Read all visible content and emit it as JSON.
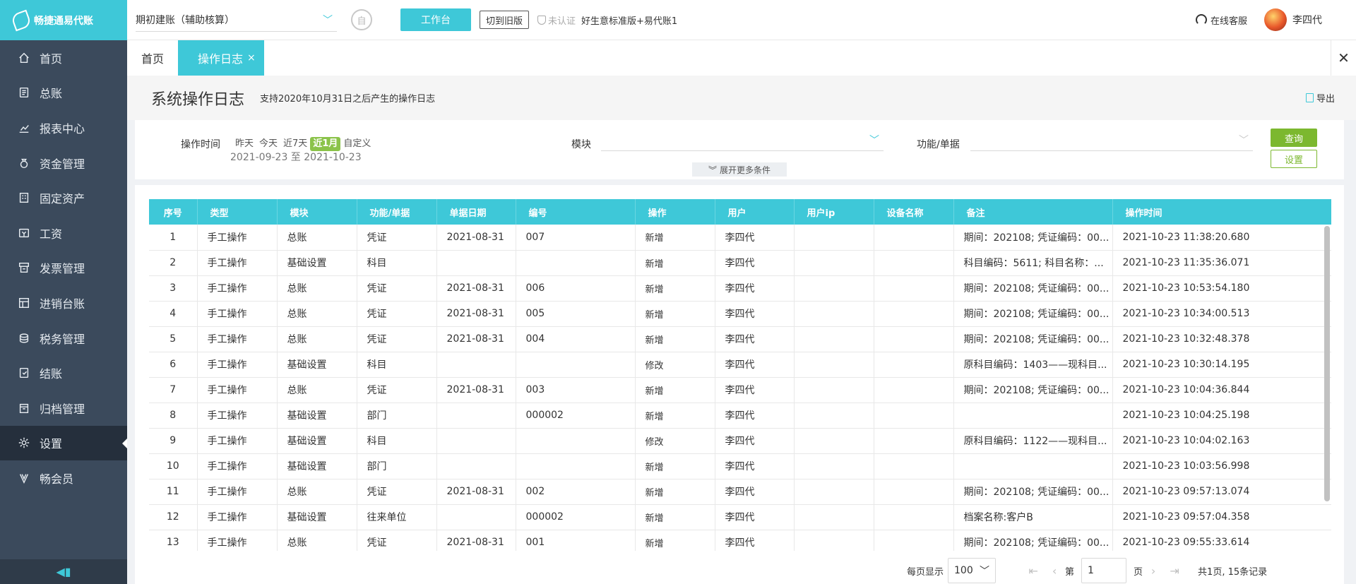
{
  "app": {
    "logo_text": "畅捷通易代账"
  },
  "sidebar": {
    "items": [
      {
        "label": "首页",
        "icon": "home-icon"
      },
      {
        "label": "总账",
        "icon": "ledger-icon"
      },
      {
        "label": "报表中心",
        "icon": "chart-icon"
      },
      {
        "label": "资金管理",
        "icon": "money-bag-icon"
      },
      {
        "label": "固定资产",
        "icon": "building-icon"
      },
      {
        "label": "工资",
        "icon": "salary-icon"
      },
      {
        "label": "发票管理",
        "icon": "invoice-icon"
      },
      {
        "label": "进销台账",
        "icon": "inventory-icon"
      },
      {
        "label": "税务管理",
        "icon": "tax-icon"
      },
      {
        "label": "结账",
        "icon": "checkout-icon"
      },
      {
        "label": "归档管理",
        "icon": "archive-icon"
      },
      {
        "label": "设置",
        "icon": "gear-icon",
        "active": true
      },
      {
        "label": "畅会员",
        "icon": "vip-icon"
      }
    ],
    "collapse_icon": "collapse-icon"
  },
  "topbar": {
    "book_select": "期初建账（辅助核算）",
    "circle_btn": "自",
    "workbench": "工作台",
    "old_version": "切到旧版",
    "cert_status": "未认证",
    "version": "好生意标准版+易代账1",
    "service": "在线客服",
    "username": "李四代"
  },
  "tabs": [
    {
      "label": "首页"
    },
    {
      "label": "操作日志",
      "close": "×"
    }
  ],
  "page": {
    "title": "系统操作日志",
    "subtitle": "支持2020年10月31日之后产生的操作日志",
    "export": "导出"
  },
  "filter": {
    "time_label": "操作时间",
    "quick": [
      "昨天",
      "今天",
      "近7天",
      "近1月",
      "自定义"
    ],
    "quick_active": "近1月",
    "range": "2021-09-23 至 2021-10-23",
    "module_label": "模块",
    "module_value": "",
    "func_label": "功能/单据",
    "func_value": "",
    "expand": "展开更多条件",
    "query": "查询",
    "settings": "设置"
  },
  "table": {
    "columns": [
      "序号",
      "类型",
      "模块",
      "功能/单据",
      "单据日期",
      "编号",
      "操作",
      "用户",
      "用户ip",
      "设备名称",
      "备注",
      "操作时间"
    ],
    "rows": [
      [
        "1",
        "手工操作",
        "总账",
        "凭证",
        "2021-08-31",
        "007",
        "新增",
        "李四代",
        "",
        "",
        "期间：202108; 凭证编码：00...",
        "2021-10-23 11:38:20.680"
      ],
      [
        "2",
        "手工操作",
        "基础设置",
        "科目",
        "",
        "",
        "新增",
        "李四代",
        "",
        "",
        "科目编码：5611; 科目名称：...",
        "2021-10-23 11:35:36.071"
      ],
      [
        "3",
        "手工操作",
        "总账",
        "凭证",
        "2021-08-31",
        "006",
        "新增",
        "李四代",
        "",
        "",
        "期间：202108; 凭证编码：00...",
        "2021-10-23 10:53:54.180"
      ],
      [
        "4",
        "手工操作",
        "总账",
        "凭证",
        "2021-08-31",
        "005",
        "新增",
        "李四代",
        "",
        "",
        "期间：202108; 凭证编码：00...",
        "2021-10-23 10:34:00.513"
      ],
      [
        "5",
        "手工操作",
        "总账",
        "凭证",
        "2021-08-31",
        "004",
        "新增",
        "李四代",
        "",
        "",
        "期间：202108; 凭证编码：00...",
        "2021-10-23 10:32:48.378"
      ],
      [
        "6",
        "手工操作",
        "基础设置",
        "科目",
        "",
        "",
        "修改",
        "李四代",
        "",
        "",
        "原科目编码：1403——现科目...",
        "2021-10-23 10:30:14.195"
      ],
      [
        "7",
        "手工操作",
        "总账",
        "凭证",
        "2021-08-31",
        "003",
        "新增",
        "李四代",
        "",
        "",
        "期间：202108; 凭证编码：00...",
        "2021-10-23 10:04:36.844"
      ],
      [
        "8",
        "手工操作",
        "基础设置",
        "部门",
        "",
        "000002",
        "新增",
        "李四代",
        "",
        "",
        "",
        "2021-10-23 10:04:25.198"
      ],
      [
        "9",
        "手工操作",
        "基础设置",
        "科目",
        "",
        "",
        "修改",
        "李四代",
        "",
        "",
        "原科目编码：1122——现科目...",
        "2021-10-23 10:04:02.163"
      ],
      [
        "10",
        "手工操作",
        "基础设置",
        "部门",
        "",
        "",
        "新增",
        "李四代",
        "",
        "",
        "",
        "2021-10-23 10:03:56.998"
      ],
      [
        "11",
        "手工操作",
        "总账",
        "凭证",
        "2021-08-31",
        "002",
        "新增",
        "李四代",
        "",
        "",
        "期间：202108; 凭证编码：00...",
        "2021-10-23 09:57:13.074"
      ],
      [
        "12",
        "手工操作",
        "基础设置",
        "往来单位",
        "",
        "000002",
        "新增",
        "李四代",
        "",
        "",
        "档案名称:客户B",
        "2021-10-23 09:57:04.358"
      ],
      [
        "13",
        "手工操作",
        "总账",
        "凭证",
        "2021-08-31",
        "001",
        "新增",
        "李四代",
        "",
        "",
        "期间：202108; 凭证编码：00...",
        "2021-10-23 09:55:33.614"
      ]
    ]
  },
  "pager": {
    "size_label": "每页显示",
    "size_value": "100",
    "page_prefix": "第",
    "page_value": "1",
    "page_suffix": "页",
    "total": "共1页, 15条记录"
  },
  "colors": {
    "accent": "#3ec8d8",
    "sidebar": "#3b4a5c",
    "green": "#7cb82f"
  }
}
